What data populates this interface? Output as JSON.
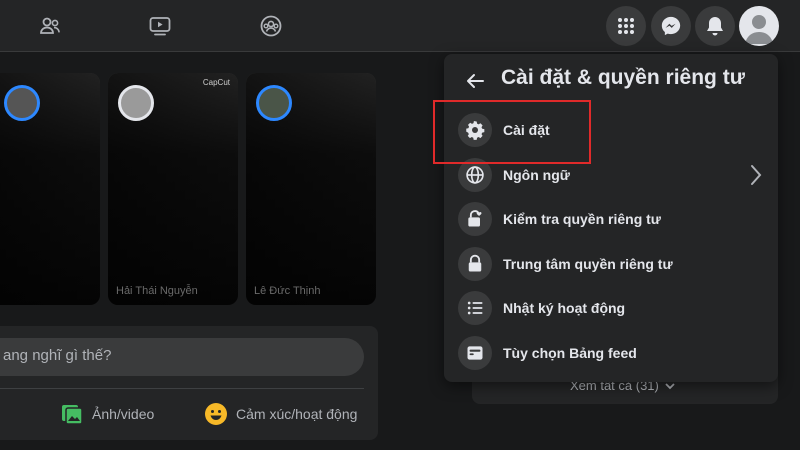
{
  "menu": {
    "title": "Cài đặt & quyền riêng tư",
    "items": [
      {
        "label": "Cài đặt",
        "icon": "gear-icon"
      },
      {
        "label": "Ngôn ngữ",
        "icon": "globe-icon"
      },
      {
        "label": "Kiểm tra quyền riêng tư",
        "icon": "lock-heart-icon"
      },
      {
        "label": "Trung tâm quyền riêng tư",
        "icon": "lock-icon"
      },
      {
        "label": "Nhật ký hoạt động",
        "icon": "list-icon"
      },
      {
        "label": "Tùy chọn Bảng feed",
        "icon": "feed-icon"
      }
    ]
  },
  "feed": {
    "see_all": "Xem tất cả (31)"
  },
  "stories": [
    {
      "name": ""
    },
    {
      "name": "Hải Thái Nguyễn",
      "badge": "CapCut"
    },
    {
      "name": "Lê Đức Thịnh"
    }
  ],
  "composer": {
    "placeholder": "ang nghĩ gì thế?",
    "photo_label": "Ảnh/video",
    "feeling_label": "Cảm xúc/hoạt động"
  },
  "colors": {
    "highlight": "#e02a2a",
    "background": "#18191a",
    "surface": "#242526",
    "accent": "#2d88ff"
  }
}
